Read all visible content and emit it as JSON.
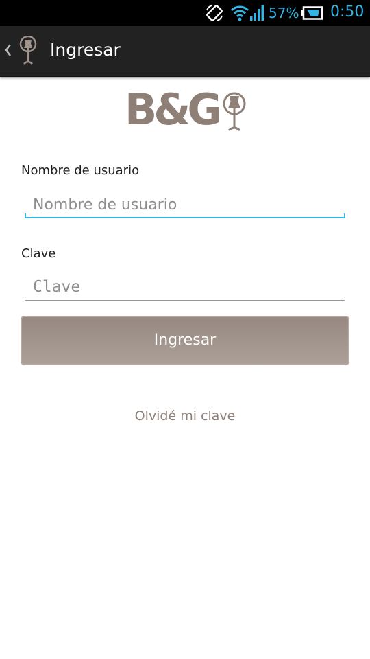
{
  "status_bar": {
    "battery_percent": "57%",
    "time": "0:50",
    "icons": [
      "screen-rotation-icon",
      "wifi-icon",
      "signal-icon",
      "battery-icon"
    ],
    "accent_color": "#33b5e5"
  },
  "action_bar": {
    "title": "Ingresar",
    "icons": [
      "back-chevron-icon",
      "mannequin-app-icon"
    ]
  },
  "logo": {
    "text": "B&G",
    "icon": "mannequin-logo-icon",
    "color": "#8e7f77"
  },
  "form": {
    "username": {
      "label": "Nombre de usuario",
      "placeholder": "Nombre de usuario",
      "value": ""
    },
    "password": {
      "label": "Clave",
      "placeholder": "Clave",
      "value": ""
    },
    "submit_label": "Ingresar",
    "forgot_label": "Olvidé mi clave"
  },
  "colors": {
    "button": "#a0938b",
    "focus_underline": "#33b5e5",
    "link": "#8e7f77"
  }
}
